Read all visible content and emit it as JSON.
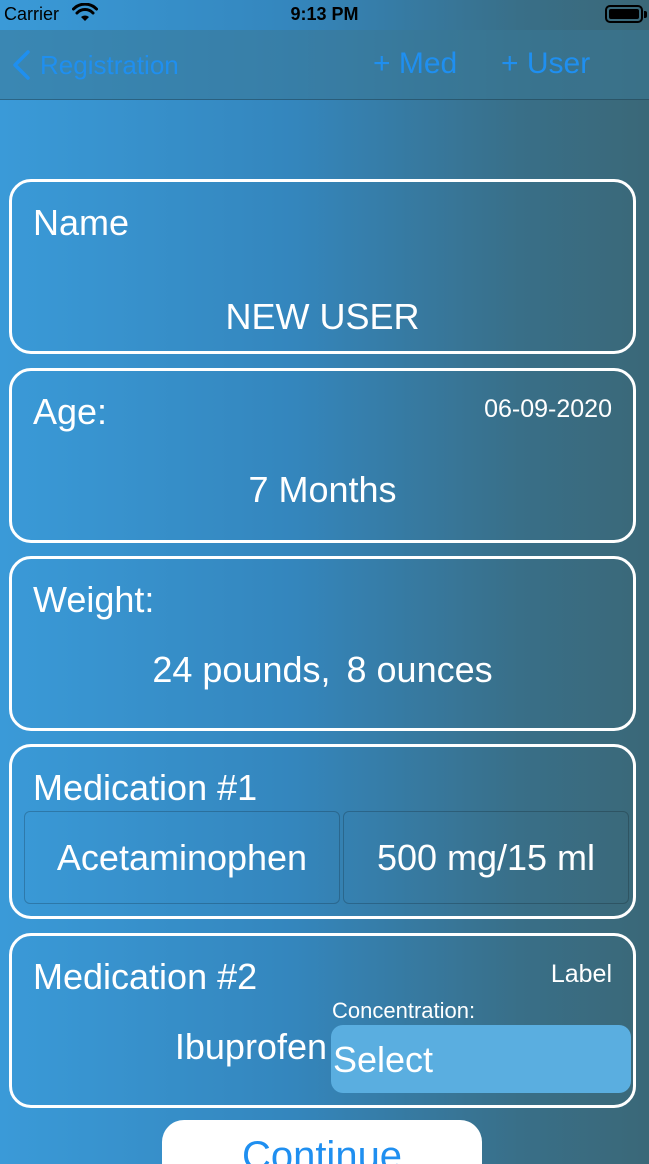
{
  "status_bar": {
    "carrier": "Carrier",
    "time": "9:13 PM",
    "wifi_icon": "wifi-icon",
    "battery_icon": "battery-icon",
    "battery_level": 1.0
  },
  "nav": {
    "back_label": "Registration",
    "back_icon": "chevron-left-icon",
    "add_med_label": "+ Med",
    "add_user_label": "+ User",
    "accent_color": "#1f8ff0"
  },
  "name_card": {
    "label": "Name",
    "value": "NEW USER"
  },
  "age_card": {
    "label": "Age:",
    "date": "06-09-2020",
    "value": "7 Months"
  },
  "weight_card": {
    "label": "Weight:",
    "pounds": "24 pounds,",
    "ounces": "8 ounces"
  },
  "medication1_card": {
    "label": "Medication #1",
    "medication": "Acetaminophen",
    "concentration": "500 mg/15 ml"
  },
  "medication2_card": {
    "label": "Medication #2",
    "side_label": "Label",
    "medication": "Ibuprofen",
    "concentration_caption": "Concentration:",
    "concentration_select": "Select"
  },
  "continue_label": "Continue"
}
